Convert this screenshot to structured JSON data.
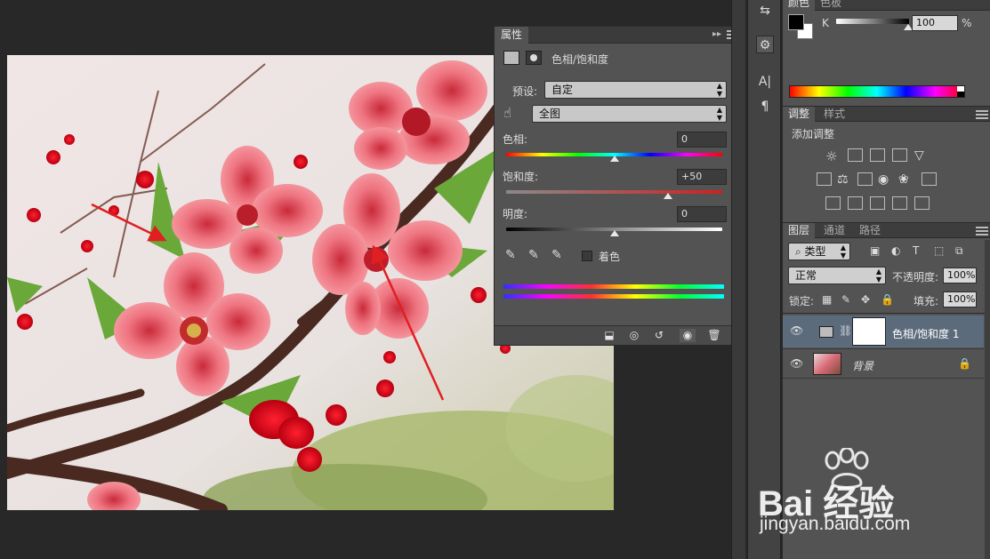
{
  "properties_panel": {
    "tab_label": "属性",
    "adjustment_title": "色相/饱和度",
    "preset_label": "预设:",
    "preset_value": "自定",
    "channel_value": "全图",
    "hue_label": "色相:",
    "hue_value": "0",
    "saturation_label": "饱和度:",
    "saturation_value": "+50",
    "lightness_label": "明度:",
    "lightness_value": "0",
    "colorize_label": "着色",
    "hue_level": 0.5,
    "saturation_level": 0.75,
    "lightness_level": 0.5
  },
  "color_panel": {
    "tabs": [
      "颜色",
      "色板"
    ],
    "channel_label": "K",
    "k_value": "100",
    "percent_label": "%"
  },
  "adjustments_panel": {
    "tabs": [
      "调整",
      "样式"
    ],
    "add_adjustment_label": "添加调整"
  },
  "layers_panel": {
    "tabs": [
      "图层",
      "通道",
      "路径"
    ],
    "filter_kind": "类型",
    "blend_mode": "正常",
    "opacity_label": "不透明度:",
    "opacity_value": "100%",
    "lock_label": "锁定:",
    "fill_label": "填充:",
    "fill_value": "100%",
    "layers": [
      {
        "name": "色相/饱和度 1",
        "selected": true
      },
      {
        "name": "背景",
        "selected": false
      }
    ]
  },
  "watermark": {
    "brand": "Bai 经验",
    "url": "jingyan.baidu.com"
  },
  "colors": {
    "panel_bg": "#535353",
    "canvas_bg": "#282828",
    "selected_layer": "#5c6b7c",
    "annotation_arrow": "#e02020"
  }
}
